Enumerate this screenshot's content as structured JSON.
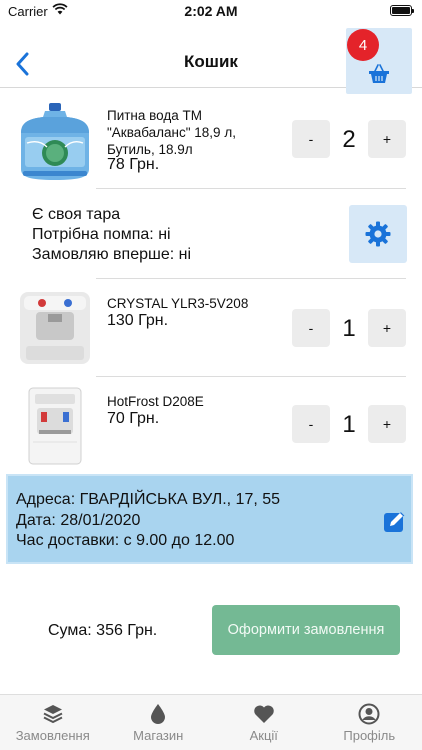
{
  "status_bar": {
    "carrier": "Carrier",
    "time": "2:02 AM"
  },
  "header": {
    "title": "Кошик",
    "cart_badge": "4"
  },
  "cart_items": [
    {
      "name": "Питна вода ТМ \"Аквабаланс\" 18,9 л, Бутиль, 18.9л",
      "price": "78 Грн.",
      "qty": "2",
      "minus": "-",
      "plus": "+"
    },
    {
      "name": "CRYSTAL YLR3-5V208",
      "price": "130 Грн.",
      "qty": "1",
      "minus": "-",
      "plus": "+"
    },
    {
      "name": "HotFrost D208E",
      "price": "70 Грн.",
      "qty": "1",
      "minus": "-",
      "plus": "+"
    }
  ],
  "options": {
    "own_container": "Є своя тара",
    "need_pump": "Потрібна помпа: ні",
    "first_order": "Замовляю вперше: ні"
  },
  "delivery": {
    "address": "Адреса: ГВАРДІЙСЬКА ВУЛ., 17, 55",
    "date": "Дата: 28/01/2020",
    "time": "Час доставки: с 9.00 до 12.00"
  },
  "summary": {
    "total": "Сума: 356 Грн.",
    "order_button": "Оформити замовлення"
  },
  "tabs": [
    {
      "label": "Замовлення",
      "icon": "layers-icon"
    },
    {
      "label": "Магазин",
      "icon": "drop-icon"
    },
    {
      "label": "Акції",
      "icon": "heart-icon"
    },
    {
      "label": "Профіль",
      "icon": "profile-icon"
    }
  ],
  "colors": {
    "accent": "#1a73d9",
    "badge": "#e4232a",
    "address_bg": "#a9d4ef",
    "order_button": "#74b994",
    "light_blue": "#d7e8f7"
  }
}
